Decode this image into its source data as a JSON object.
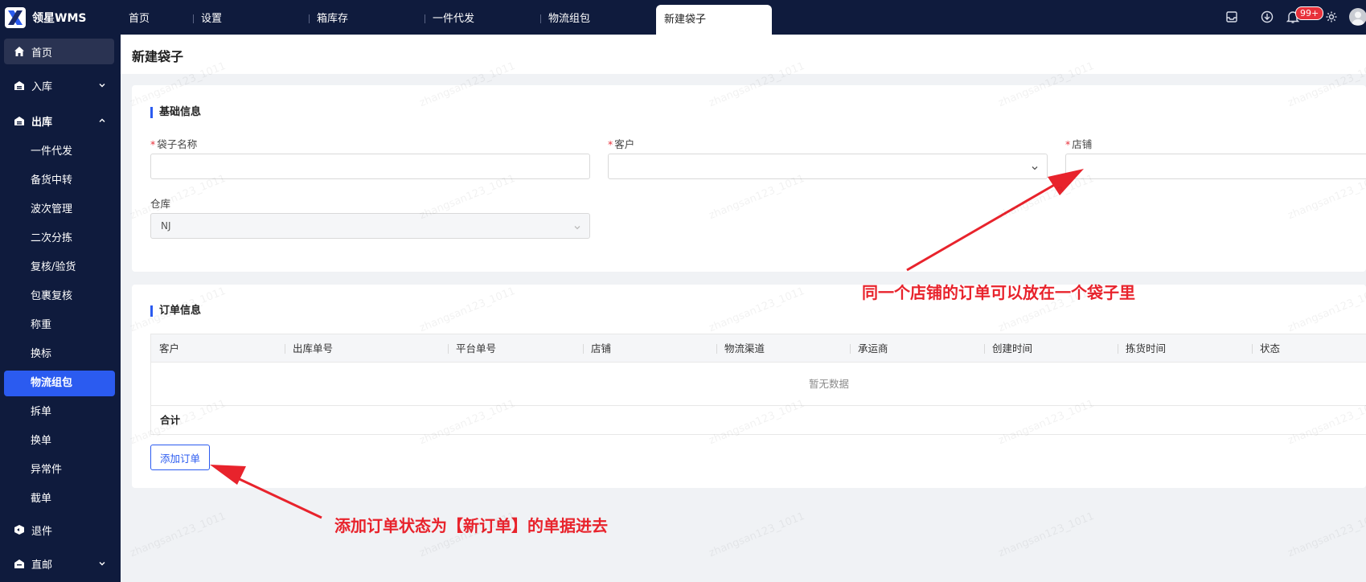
{
  "app": {
    "name": "领星WMS"
  },
  "tabs": [
    {
      "label": "首页"
    },
    {
      "label": "设置"
    },
    {
      "label": "箱库存"
    },
    {
      "label": "一件代发"
    },
    {
      "label": "物流组包"
    },
    {
      "label": "新建袋子",
      "active": true
    }
  ],
  "notifications": {
    "badge": "99+"
  },
  "sidebar": {
    "home": "首页",
    "inbound": "入库",
    "outbound": "出库",
    "outbound_items": [
      "一件代发",
      "备货中转",
      "波次管理",
      "二次分拣",
      "复核/验货",
      "包裹复核",
      "称重",
      "换标",
      "物流组包",
      "拆单",
      "换单",
      "异常件",
      "截单"
    ],
    "active_item": "物流组包",
    "returns": "退件",
    "direct_mail": "直邮"
  },
  "page": {
    "title": "新建袋子"
  },
  "basic_info": {
    "section_title": "基础信息",
    "bag_name_label": "袋子名称",
    "customer_label": "客户",
    "store_label": "店铺",
    "warehouse_label": "仓库",
    "warehouse_value": "NJ",
    "required_mark": "*"
  },
  "order_info": {
    "section_title": "订单信息",
    "columns": [
      "客户",
      "出库单号",
      "平台单号",
      "店铺",
      "物流渠道",
      "承运商",
      "创建时间",
      "拣货时间",
      "状态"
    ],
    "empty_text": "暂无数据",
    "total_label": "合计",
    "add_button": "添加订单"
  },
  "annotations": {
    "store_note": "同一个店铺的订单可以放在一个袋子里",
    "add_note": "添加订单状态为【新订单】的单据进去"
  },
  "watermark": "zhangsan123_1011",
  "colors": {
    "accent": "#2b5bf0",
    "nav_bg": "#0f1b3d",
    "annotation": "#e8232c",
    "required": "#e8313b"
  }
}
